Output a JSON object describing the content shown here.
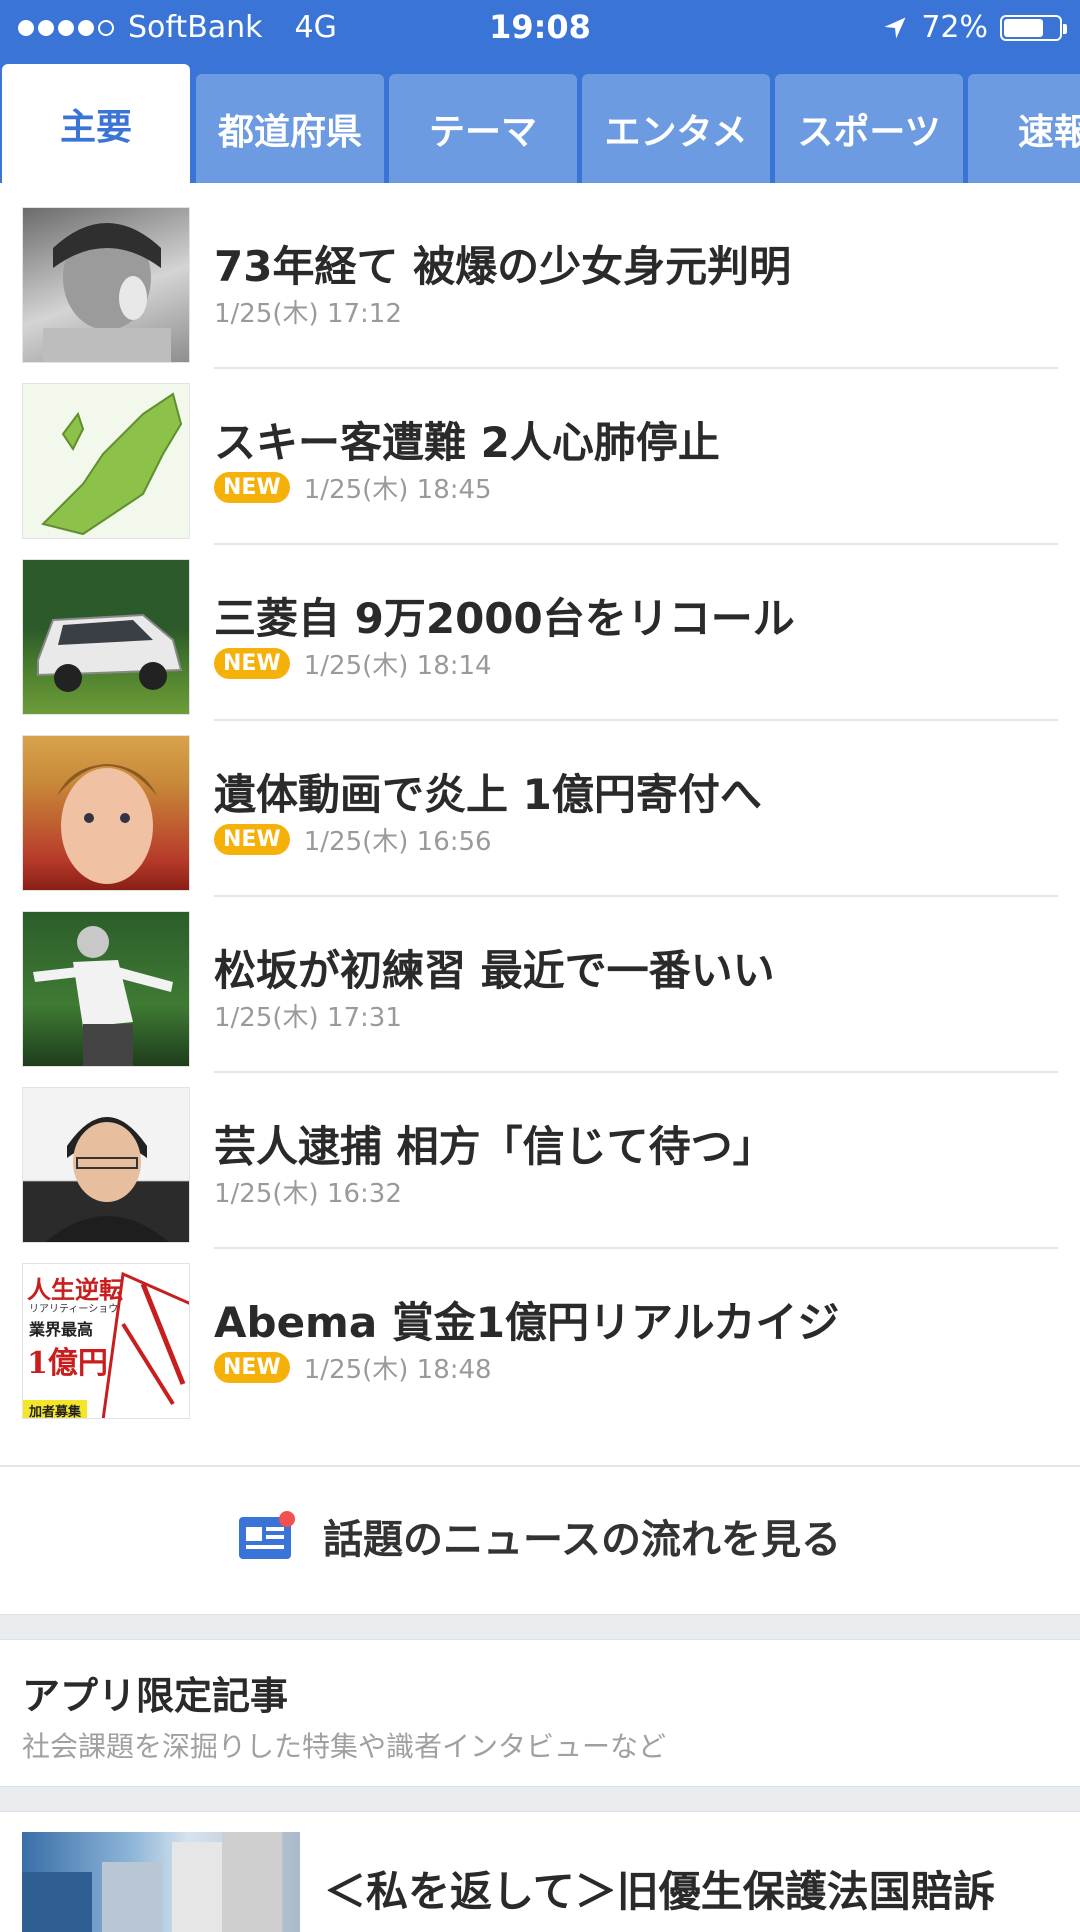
{
  "status_bar": {
    "carrier": "SoftBank",
    "network": "4G",
    "time": "19:08",
    "battery": "72%",
    "battery_level": 0.72,
    "signal_bars": 4,
    "signal_total": 5
  },
  "tabs": [
    {
      "label": "主要",
      "active": true
    },
    {
      "label": "都道府県",
      "active": false
    },
    {
      "label": "テーマ",
      "active": false
    },
    {
      "label": "エンタメ",
      "active": false
    },
    {
      "label": "スポーツ",
      "active": false
    },
    {
      "label": "速報",
      "active": false
    }
  ],
  "news": [
    {
      "title": "73年経て 被爆の少女身元判明",
      "time": "1/25(木) 17:12",
      "new": false
    },
    {
      "title": "スキー客遭難 2人心肺停止",
      "time": "1/25(木) 18:45",
      "new": true
    },
    {
      "title": "三菱自 9万2000台をリコール",
      "time": "1/25(木) 18:14",
      "new": true
    },
    {
      "title": "遺体動画で炎上 1億円寄付へ",
      "time": "1/25(木) 16:56",
      "new": true
    },
    {
      "title": "松坂が初練習 最近で一番いい",
      "time": "1/25(木) 17:31",
      "new": false
    },
    {
      "title": "芸人逮捕 相方「信じて待つ」",
      "time": "1/25(木) 16:32",
      "new": false
    },
    {
      "title": "Abema 賞金1億円リアルカイジ",
      "time": "1/25(木) 18:48",
      "new": true
    }
  ],
  "new_badge_label": "NEW",
  "flow_link": {
    "label": "話題のニュースの流れを見る"
  },
  "app_section": {
    "title": "アプリ限定記事",
    "subtitle": "社会課題を深掘りした特集や識者インタビューなど"
  },
  "featured": {
    "title": "＜私を返して＞旧優生保護法国賠訴"
  },
  "poster_text": {
    "line1": "人生逆転",
    "line2": "リアリティーショウ",
    "line3": "業界最高",
    "line4": "1億円",
    "line5": "加者募集"
  },
  "colors": {
    "accent": "#3a74d6",
    "tab_inactive": "#6d9be2",
    "new_badge": "#f5b10a"
  }
}
